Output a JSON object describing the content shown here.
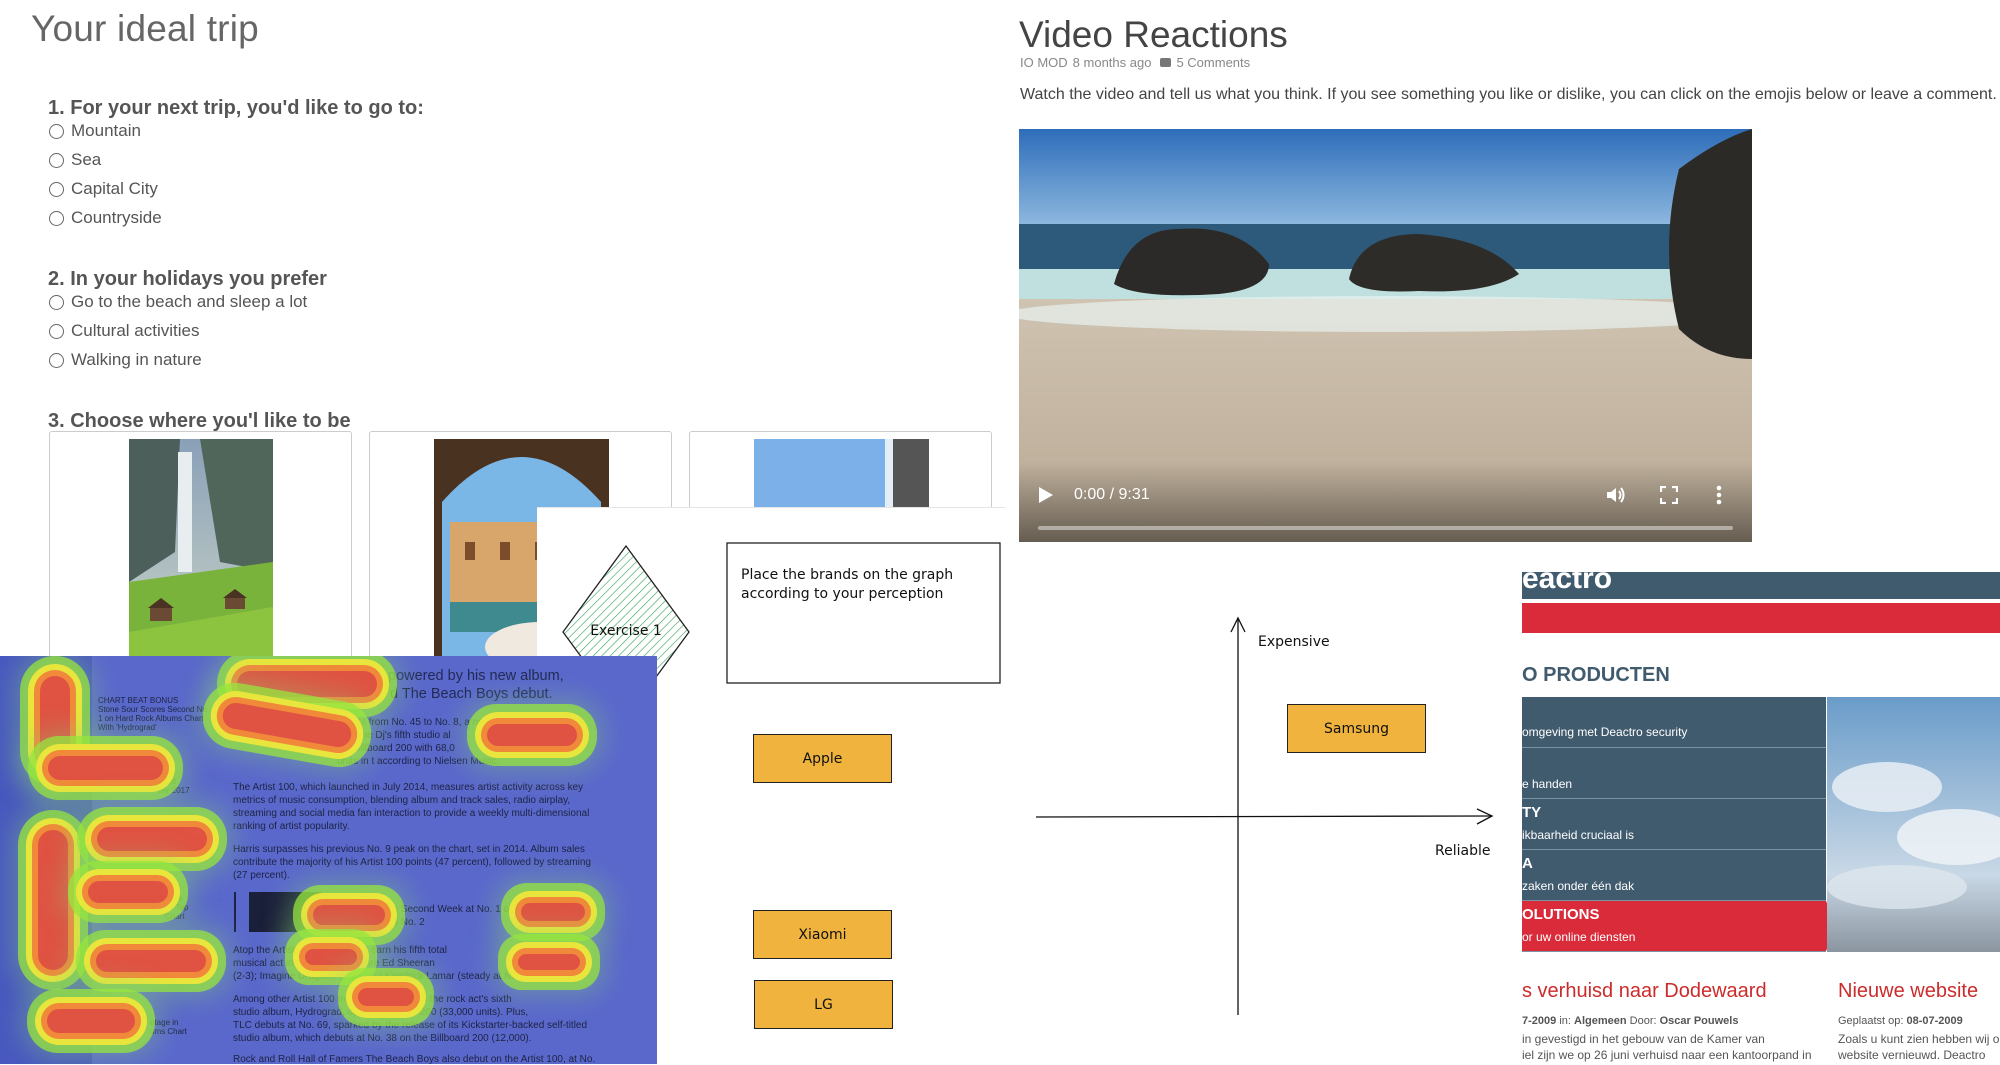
{
  "survey": {
    "title": "Your ideal trip",
    "questions": [
      {
        "title": "1. For your next trip, you'd like to go to:",
        "options": [
          "Mountain",
          "Sea",
          "Capital City",
          "Countryside"
        ]
      },
      {
        "title": "2. In your holidays you prefer",
        "options": [
          "Go to the beach and sleep a lot",
          "Cultural activities",
          "Walking in nature"
        ]
      },
      {
        "title": "3. Choose where you'l like to be"
      }
    ]
  },
  "video": {
    "title": "Video Reactions",
    "author": "IO MOD",
    "time_ago": "8 months ago",
    "comments": "5 Comments",
    "description": "Watch the video and tell us what you think. If you see something you like or dislike, you can click on the emojis below or leave a comment.",
    "time_display": "0:00 / 9:31",
    "progress": 0
  },
  "sketch": {
    "exercise_label": "Exercise 1",
    "instruction_line1": "Place the brands on the graph",
    "instruction_line2": "according to your perception",
    "y_axis_label": "Expensive",
    "x_axis_label": "Reliable",
    "brands": [
      "Apple",
      "Xiaomi",
      "LG"
    ],
    "placed_brand": "Samsung"
  },
  "heatmap": {
    "headline_line1": "powered by his new album,",
    "headline_line2": "d The Beach Boys debut.",
    "side_caption": [
      "CHART BEAT BONUS",
      "Stone Sour Scores Second No.",
      "1 on Hard Rock Albums Chart",
      "With 'Hydrograd'"
    ],
    "side_caption2": [
      "& Ed",
      "Lead",
      "ear 2017"
    ],
    "side_caption3": [
      "Love",
      "ds Top",
      "Chart"
    ],
    "side_caption4": [
      "ntage in",
      "ums Chart"
    ],
    "para1": [
      "ockets from No. 45 to No. 8, a new peak",
      "d by the Dj's fifth studio al",
      "the Billboard 200 with 68,0",
      "units in t        according to Nielsen Music."
    ],
    "para2": [
      "The Artist 100, which launched in July 2014, measures artist activity across key",
      "metrics of music consumption, blending album and track sales, radio airplay,",
      "streaming and social media fan interaction to provide a weekly multi-dimensional",
      "ranking of artist popularity."
    ],
    "para3": [
      "Harris surpasses his previous No. 9 peak on the chart, set in 2014. Album sales",
      "contribute the majority of his Artist 100 points (47 percent), followed by streaming",
      "(27 percent)."
    ],
    "para4": [
      "s Second Week at No. 1 on Bil",
      "s No. 2"
    ],
    "para5": [
      "Atop the Artist          rebounds 3-1 to earn his fifth total",
      "musical act in          out the top five are Ed Sheeran",
      "(2-3); Imagine Dragons (1-4); and Kendrick Lamar (steady at No. 5)."
    ],
    "para6": [
      "Among other Artist 100 m           buts at No. 13, as the rock act's sixth",
      "studio album, Hydrograd, op           the Billboard 200 (33,000 units). Plus,",
      "TLC debuts at No. 69, sparked by the release of its Kickstarter-backed self-titled",
      "studio album, which debuts at No. 38 on the Billboard 200 (12,000)."
    ],
    "para7": "Rock and Roll Hall of Famers The Beach Boys also debut on the Artist 100, at No."
  },
  "deactro": {
    "brand_fragment": "eactro",
    "section_title": "O PRODUCTEN",
    "menu": [
      {
        "title": "",
        "sub": "omgeving met Deactro security"
      },
      {
        "title": "",
        "sub": "e handen"
      },
      {
        "title": "TY",
        "sub": "ikbaarheid cruciaal is"
      },
      {
        "title": "A",
        "sub": "zaken onder één dak"
      },
      {
        "title": "OLUTIONS",
        "sub": "or uw online diensten"
      }
    ],
    "news": [
      {
        "title": "s verhuisd naar Dodewaard",
        "meta_date": "7-2009",
        "meta_in_label": " in: ",
        "meta_category": "Algemeen",
        "meta_by_label": " Door: ",
        "meta_author": "Oscar Pouwels",
        "body1": "in gevestigd in het gebouw van de Kamer van",
        "body2": "iel zijn we op 26 juni verhuisd naar een kantoorpand in"
      },
      {
        "title": "Nieuwe website",
        "meta_label": "Geplaatst op: ",
        "meta_date": "08-07-2009",
        "body1": "Zoals u kunt zien hebben wij o",
        "body2": "website vernieuwd. Deactro"
      }
    ]
  },
  "colors": {
    "brand_box": "#f0b33d",
    "deactro_menu": "#405a6e",
    "deactro_red": "#d92b3a",
    "heatmap_bg": "#5a68cc"
  }
}
